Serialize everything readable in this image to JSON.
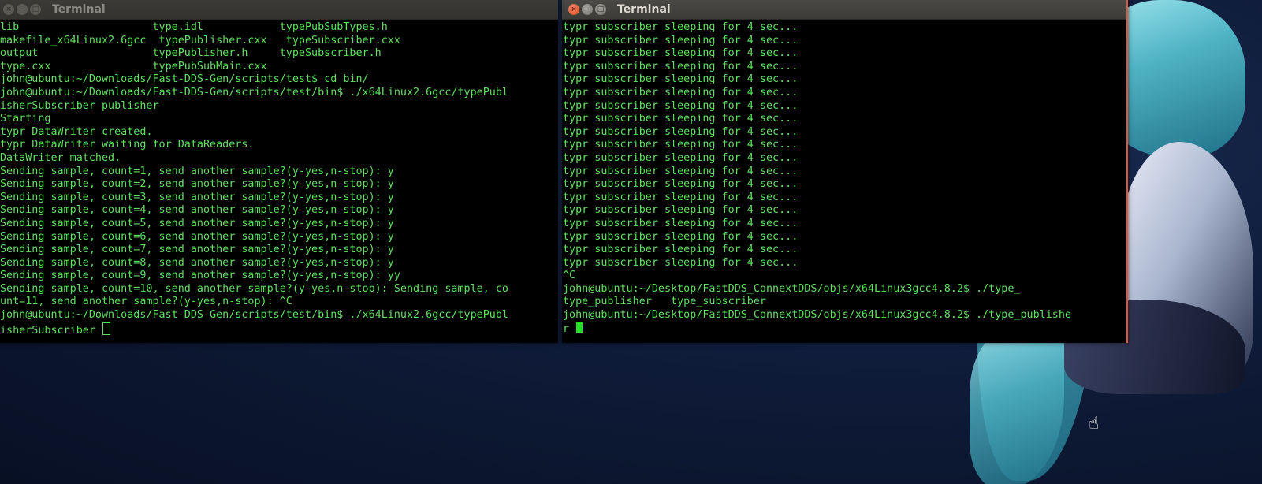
{
  "left_terminal": {
    "title": "Terminal",
    "lines": [
      "lib                     type.idl            typePubSubTypes.h",
      "makefile_x64Linux2.6gcc  typePublisher.cxx   typeSubscriber.cxx",
      "output                  typePublisher.h     typeSubscriber.h",
      "type.cxx                typePubSubMain.cxx",
      "john@ubuntu:~/Downloads/Fast-DDS-Gen/scripts/test$ cd bin/",
      "john@ubuntu:~/Downloads/Fast-DDS-Gen/scripts/test/bin$ ./x64Linux2.6gcc/typePubl",
      "isherSubscriber publisher",
      "Starting",
      "typr DataWriter created.",
      "typr DataWriter waiting for DataReaders.",
      "DataWriter matched.",
      "Sending sample, count=1, send another sample?(y-yes,n-stop): y",
      "Sending sample, count=2, send another sample?(y-yes,n-stop): y",
      "Sending sample, count=3, send another sample?(y-yes,n-stop): y",
      "Sending sample, count=4, send another sample?(y-yes,n-stop): y",
      "Sending sample, count=5, send another sample?(y-yes,n-stop): y",
      "Sending sample, count=6, send another sample?(y-yes,n-stop): y",
      "Sending sample, count=7, send another sample?(y-yes,n-stop): y",
      "Sending sample, count=8, send another sample?(y-yes,n-stop): y",
      "Sending sample, count=9, send another sample?(y-yes,n-stop): yy",
      "Sending sample, count=10, send another sample?(y-yes,n-stop): Sending sample, co",
      "unt=11, send another sample?(y-yes,n-stop): ^C",
      "john@ubuntu:~/Downloads/Fast-DDS-Gen/scripts/test/bin$ ./x64Linux2.6gcc/typePubl"
    ],
    "last_line": "isherSubscriber "
  },
  "right_terminal": {
    "title": "Terminal",
    "lines": [
      "typr subscriber sleeping for 4 sec...",
      "typr subscriber sleeping for 4 sec...",
      "typr subscriber sleeping for 4 sec...",
      "typr subscriber sleeping for 4 sec...",
      "typr subscriber sleeping for 4 sec...",
      "typr subscriber sleeping for 4 sec...",
      "typr subscriber sleeping for 4 sec...",
      "typr subscriber sleeping for 4 sec...",
      "typr subscriber sleeping for 4 sec...",
      "typr subscriber sleeping for 4 sec...",
      "typr subscriber sleeping for 4 sec...",
      "typr subscriber sleeping for 4 sec...",
      "typr subscriber sleeping for 4 sec...",
      "typr subscriber sleeping for 4 sec...",
      "typr subscriber sleeping for 4 sec...",
      "typr subscriber sleeping for 4 sec...",
      "typr subscriber sleeping for 4 sec...",
      "typr subscriber sleeping for 4 sec...",
      "typr subscriber sleeping for 4 sec...",
      "^C",
      "john@ubuntu:~/Desktop/FastDDS_ConnextDDS/objs/x64Linux3gcc4.8.2$ ./type_",
      "type_publisher   type_subscriber",
      "john@ubuntu:~/Desktop/FastDDS_ConnextDDS/objs/x64Linux3gcc4.8.2$ ./type_publishe"
    ],
    "last_line": "r "
  },
  "window_buttons": {
    "close": "×",
    "minimize": "–",
    "maximize": "□"
  },
  "icons": {
    "mouse_cursor": "hand-pointer-icon"
  }
}
